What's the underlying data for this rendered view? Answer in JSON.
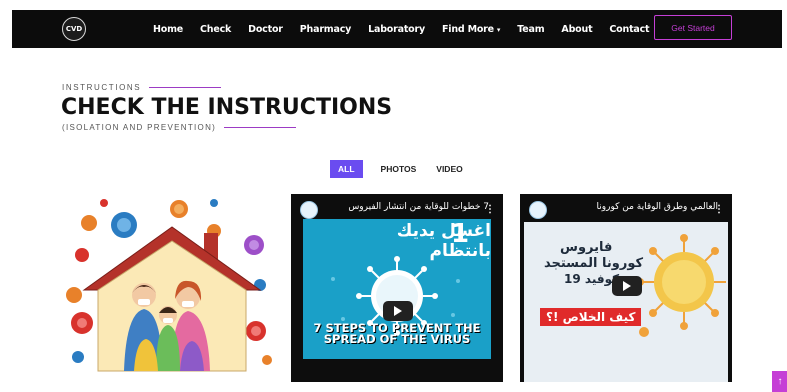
{
  "navbar": {
    "logo_text": "CVD",
    "links": [
      {
        "label": "Home"
      },
      {
        "label": "Check"
      },
      {
        "label": "Doctor"
      },
      {
        "label": "Pharmacy"
      },
      {
        "label": "Laboratory"
      },
      {
        "label": "Find More",
        "caret": "▾"
      },
      {
        "label": "Team"
      },
      {
        "label": "About"
      },
      {
        "label": "Contact"
      }
    ],
    "cta_label": "Get Started"
  },
  "section": {
    "kicker": "INSTRUCTIONS",
    "title": "CHECK THE INSTRUCTIONS",
    "subtitle": "(ISOLATION AND PREVENTION)"
  },
  "filters": [
    {
      "label": "ALL",
      "active": true
    },
    {
      "label": "PHOTOS",
      "active": false
    },
    {
      "label": "VIDEO",
      "active": false
    }
  ],
  "videos": [
    {
      "title": "7 خطوات للوقاية من انتشار الفيروس",
      "big_number": "1",
      "arabic_caption": "اغسل يديك بانتظام",
      "english_caption": "7 STEPS TO PREVENT THE SPREAD OF THE VIRUS",
      "colors": {
        "screen": "#1aa0c8"
      }
    },
    {
      "title": "العالمي وطرق الوقاية من كورونا",
      "arabic_caption_1": "فايروس",
      "arabic_caption_2": "كورونا المستجد",
      "arabic_caption_3": "كوفيد 19",
      "banner": "كيف الخلاص !؟",
      "colors": {
        "banner": "#e02a2a"
      }
    }
  ],
  "colors": {
    "accent": "#c53fd6",
    "filter_active": "#6a4cf0",
    "navbar_bg": "#0c0c0c"
  },
  "scroll_top_icon": "arrow-up-icon"
}
